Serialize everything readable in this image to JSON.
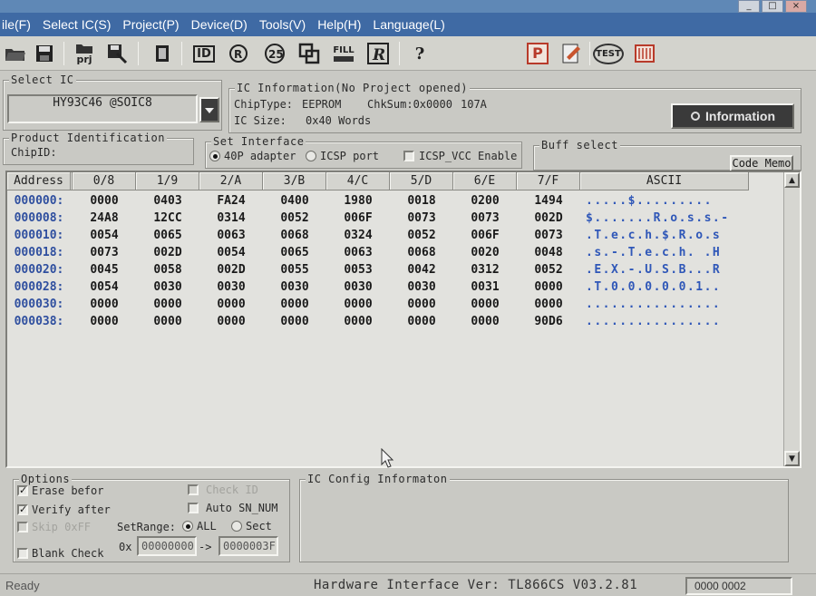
{
  "menu": [
    "ile(F)",
    "Select IC(S)",
    "Project(P)",
    "Device(D)",
    "Tools(V)",
    "Help(H)",
    "Language(L)"
  ],
  "window_buttons": [
    "_",
    "□",
    "×"
  ],
  "toolbar": {
    "prj_label": "prj",
    "id_label": "ID",
    "fill_label": "FILL",
    "help_label": "?",
    "test_label": "TEST",
    "p_label": "P"
  },
  "select_ic": {
    "legend": "Select IC",
    "value": "HY93C46 @SOIC8"
  },
  "ic_info": {
    "legend": "IC Information(No Project opened)",
    "chip_type_label": "ChipType:",
    "chip_type": "EEPROM",
    "checksum_label": "ChkSum:0x0000",
    "checksum_extra": "107A",
    "ic_size_label": "IC Size:",
    "ic_size": "0x40 Words",
    "info_button": "Information"
  },
  "product_id": {
    "legend": "Product Identification",
    "chip_id_label": "ChipID:"
  },
  "set_interface": {
    "legend": "Set Interface",
    "opt_40p": "40P adapter",
    "opt_icsp": "ICSP port",
    "icsp_vcc": "ICSP_VCC Enable"
  },
  "buff_select": {
    "legend": "Buff select",
    "code_memo": "Code Memo"
  },
  "hex": {
    "headers": [
      "Address",
      "0/8",
      "1/9",
      "2/A",
      "3/B",
      "4/C",
      "5/D",
      "6/E",
      "7/F",
      "ASCII"
    ],
    "rows": [
      [
        "000000:",
        "0000",
        "0403",
        "FA24",
        "0400",
        "1980",
        "0018",
        "0200",
        "1494",
        ".....$........."
      ],
      [
        "000008:",
        "24A8",
        "12CC",
        "0314",
        "0052",
        "006F",
        "0073",
        "0073",
        "002D",
        "$.......R.o.s.s.-"
      ],
      [
        "000010:",
        "0054",
        "0065",
        "0063",
        "0068",
        "0324",
        "0052",
        "006F",
        "0073",
        ".T.e.c.h.$.R.o.s"
      ],
      [
        "000018:",
        "0073",
        "002D",
        "0054",
        "0065",
        "0063",
        "0068",
        "0020",
        "0048",
        ".s.-.T.e.c.h. .H"
      ],
      [
        "000020:",
        "0045",
        "0058",
        "002D",
        "0055",
        "0053",
        "0042",
        "0312",
        "0052",
        ".E.X.-.U.S.B...R"
      ],
      [
        "000028:",
        "0054",
        "0030",
        "0030",
        "0030",
        "0030",
        "0030",
        "0031",
        "0000",
        ".T.0.0.0.0.0.1.."
      ],
      [
        "000030:",
        "0000",
        "0000",
        "0000",
        "0000",
        "0000",
        "0000",
        "0000",
        "0000",
        "................"
      ],
      [
        "000038:",
        "0000",
        "0000",
        "0000",
        "0000",
        "0000",
        "0000",
        "0000",
        "90D6",
        "................"
      ]
    ]
  },
  "options": {
    "legend": "Options",
    "erase_before": "Erase befor",
    "verify_after": "Verify after",
    "skip_0xff": "Skip 0xFF",
    "blank_check": "Blank Check",
    "check_id": "Check ID",
    "auto_sn": "Auto SN_NUM",
    "setrange_label": "SetRange:",
    "range_all": "ALL",
    "range_sect": "Sect",
    "hex_prefix": "0x",
    "range_from": "00000000",
    "range_arrow": "->",
    "range_to": "0000003F"
  },
  "ic_config": {
    "legend": "IC Config Informaton"
  },
  "status": {
    "ready": "Ready",
    "hw_version": "Hardware Interface Ver: TL866CS V03.2.81",
    "counter": "0000 0002"
  }
}
